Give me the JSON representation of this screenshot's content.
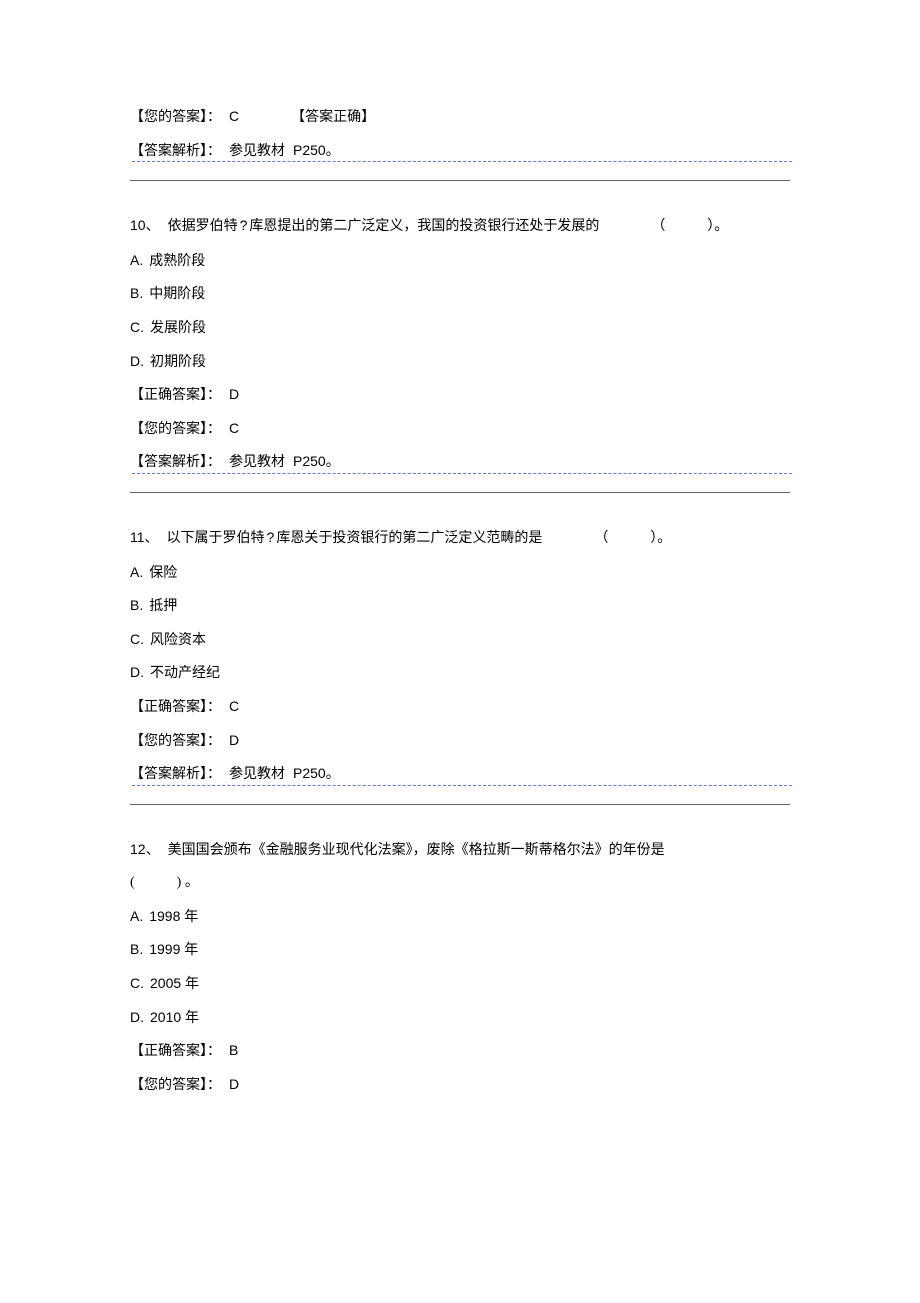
{
  "common": {
    "your_answer": "【您的答案】：",
    "correct_answer": "【正确答案】：",
    "answer_correct_tag": "【答案正确】",
    "explain_label": "【答案解析】：",
    "explain_text_prefix": "参见教材",
    "explain_text_page": "P250。",
    "blank_paren": "（　　　）。",
    "blank_paren_plain": "(　　　) 。"
  },
  "q9_tail": {
    "your_ans_val": "C"
  },
  "q10": {
    "stem_num": "10、",
    "stem_text_a": "依据罗伯特",
    "stem_qmark": "?",
    "stem_text_b": "库恩提出的第二广泛定义，我国的投资银行还处于发展的",
    "opts": {
      "A": "成熟阶段",
      "B": "中期阶段",
      "C": "发展阶段",
      "D": "初期阶段"
    },
    "correct_val": "D",
    "your_val": "C"
  },
  "q11": {
    "stem_num": "11、",
    "stem_text_a": "以下属于罗伯特",
    "stem_qmark": "?",
    "stem_text_b": "库恩关于投资银行的第二广泛定义范畴的是",
    "opts": {
      "A": "保险",
      "B": "抵押",
      "C": "风险资本",
      "D": "不动产经纪"
    },
    "correct_val": "C",
    "your_val": "D"
  },
  "q12": {
    "stem_num": "12、",
    "stem_text": "美国国会颁布《金融服务业现代化法案》，废除《格拉斯一斯蒂格尔法》的年份是",
    "opts": {
      "A": "1998 年",
      "B": "1999 年",
      "C": "2005 年",
      "D": "2010 年"
    },
    "correct_val": "B",
    "your_val": "D"
  }
}
